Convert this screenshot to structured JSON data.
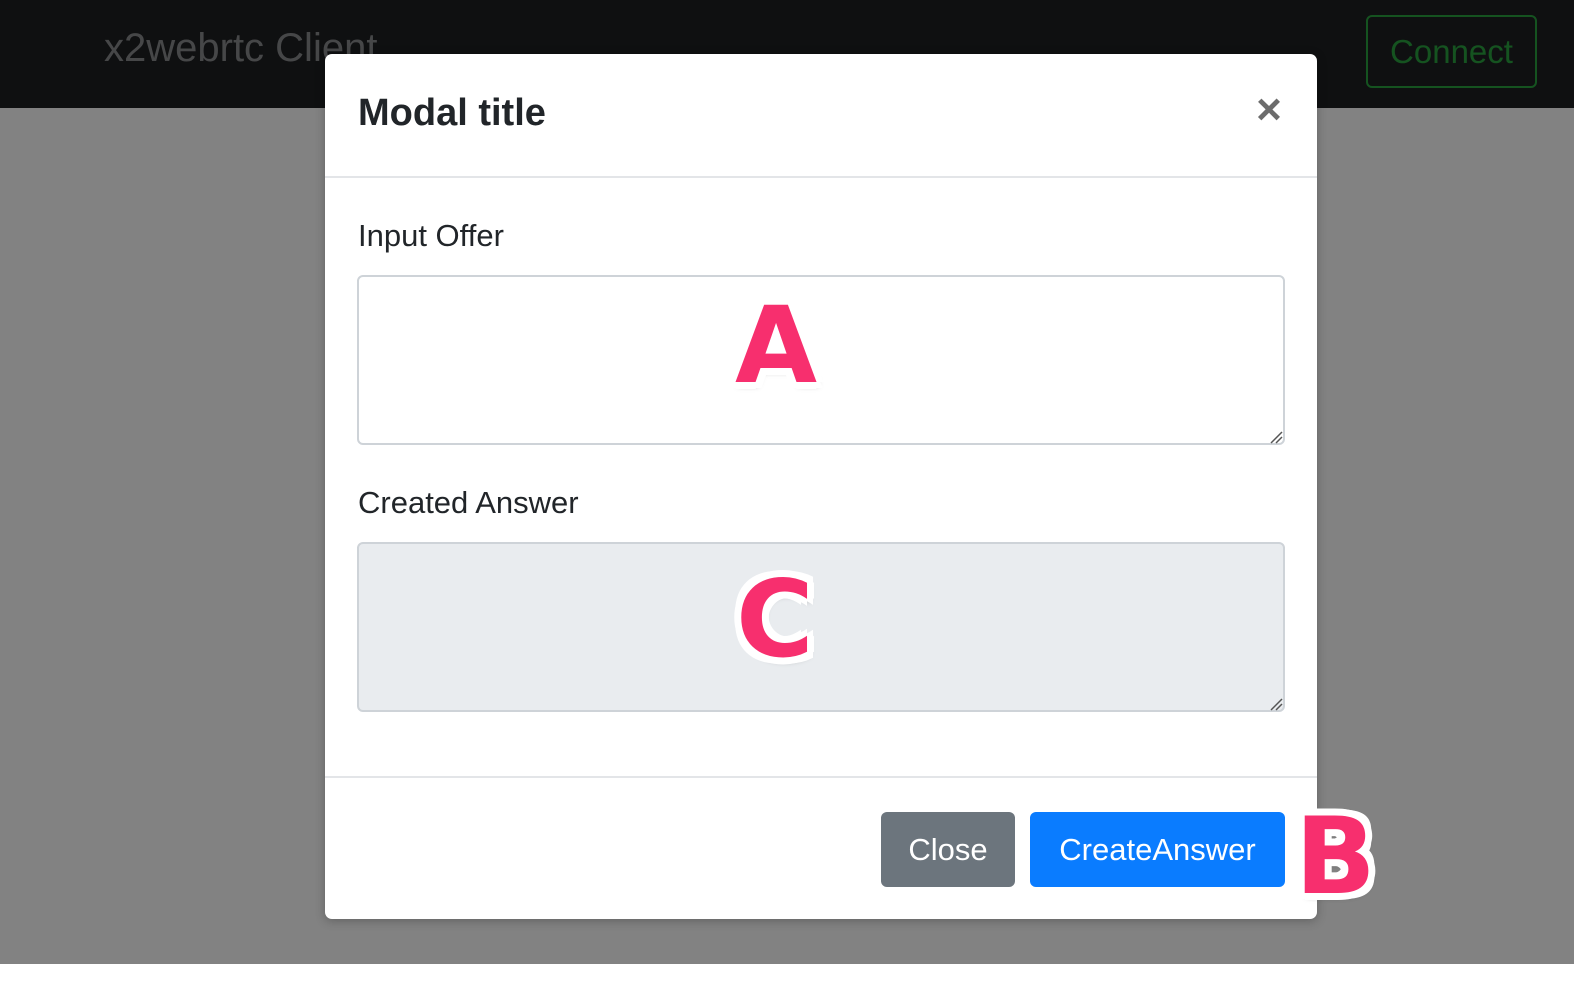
{
  "navbar": {
    "brand": "x2webrtc Client",
    "connect_label": "Connect"
  },
  "modal": {
    "title": "Modal title",
    "close_icon": "×",
    "input_offer_label": "Input Offer",
    "input_offer_value": "",
    "created_answer_label": "Created Answer",
    "created_answer_value": "",
    "close_button": "Close",
    "create_answer_button": "CreateAnswer"
  },
  "annotations": {
    "a": "A",
    "b": "B",
    "c": "C",
    "color": "#f72f6e"
  },
  "colors": {
    "navbar_bg": "#1f2023",
    "connect": "#2aa33f",
    "primary": "#0a7cff",
    "secondary": "#6c757d"
  }
}
